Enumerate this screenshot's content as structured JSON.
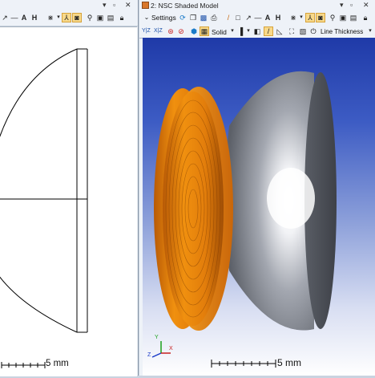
{
  "left_window": {
    "controls": [
      "▾",
      "▫",
      "✕"
    ],
    "toolbar": {
      "icons": [
        "arrow-pen-icon",
        "line-icon",
        "text-a-icon",
        "dimension-icon",
        "ray-icon",
        "trident-icon",
        "camera-icon",
        "zoom-icon",
        "screenshot-icon",
        "clipboard-icon",
        "lock-icon"
      ]
    },
    "scale_bar_label": "5 mm"
  },
  "right_window": {
    "title": "2: NSC Shaded Model",
    "controls": [
      "▾",
      "▫",
      "✕"
    ],
    "toolbar1": {
      "settings_label": "Settings",
      "icons": [
        "refresh-icon",
        "copy-icon",
        "save-icon",
        "print-icon",
        "pen-icon",
        "rectangle-icon",
        "arrow-icon",
        "line-icon",
        "text-a-icon",
        "dimension-icon",
        "ray-icon",
        "trident-icon",
        "camera-icon",
        "zoom-icon",
        "screenshot-icon",
        "clipboard-icon",
        "lock-icon"
      ]
    },
    "toolbar2": {
      "axis_labels": [
        "Y|Z",
        "X|Z"
      ],
      "render_mode_label": "Solid",
      "line_thickness_label": "Line Thickness"
    },
    "scale_bar_label": "5 mm",
    "axis_triad": [
      "Y",
      "Z",
      "X"
    ]
  },
  "colors": {
    "lens_orange": "#e07a10",
    "dome_gray": "#9a9ea8",
    "background_top": "#1f3aa8",
    "background_bottom": "#ffffff",
    "toolbar_active": "#f8d98a"
  }
}
